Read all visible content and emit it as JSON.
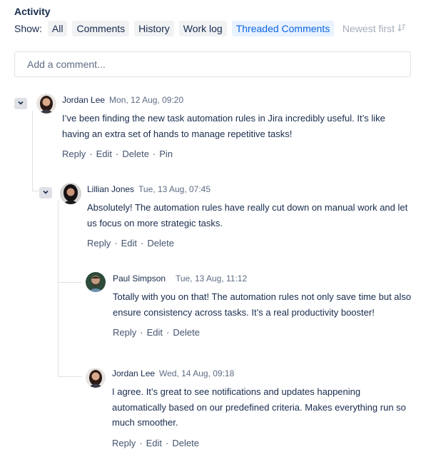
{
  "activity": {
    "title": "Activity",
    "show_label": "Show:",
    "filters": [
      "All",
      "Comments",
      "History",
      "Work log",
      "Threaded Comments"
    ],
    "active_filter": "Threaded Comments",
    "sort_label": "Newest first",
    "sort_icon": "sort-descending-icon"
  },
  "composer": {
    "placeholder": "Add a comment..."
  },
  "colors": {
    "accent": "#0c66e4",
    "text": "#172b4d",
    "muted": "#5e6c84",
    "line": "#dfe1e6"
  },
  "comments": [
    {
      "author": "Jordan Lee",
      "time": "Mon, 12 Aug, 09:20",
      "body": "I’ve been finding the new task automation rules in Jira incredibly useful. It’s like having an extra set of hands to manage repetitive tasks!",
      "actions": [
        "Reply",
        "Edit",
        "Delete",
        "Pin"
      ]
    },
    {
      "author": "Lillian Jones",
      "time": "Tue, 13 Aug, 07:45",
      "body": "Absolutely! The automation rules have really cut down on manual work and let us focus on more strategic tasks.",
      "actions": [
        "Reply",
        "Edit",
        "Delete"
      ]
    },
    {
      "author": "Paul Simpson",
      "time": "Tue, 13 Aug, 11:12",
      "body": "Totally with you on that! The automation rules not only save time but also ensure consistency across tasks. It’s a real productivity booster!",
      "actions": [
        "Reply",
        "Edit",
        "Delete"
      ]
    },
    {
      "author": "Jordan Lee",
      "time": "Wed, 14 Aug, 09:18",
      "body": "I agree. It’s great to see notifications and updates happening automatically based on our predefined criteria. Makes everything run so much smoother.",
      "actions": [
        "Reply",
        "Edit",
        "Delete"
      ]
    }
  ]
}
